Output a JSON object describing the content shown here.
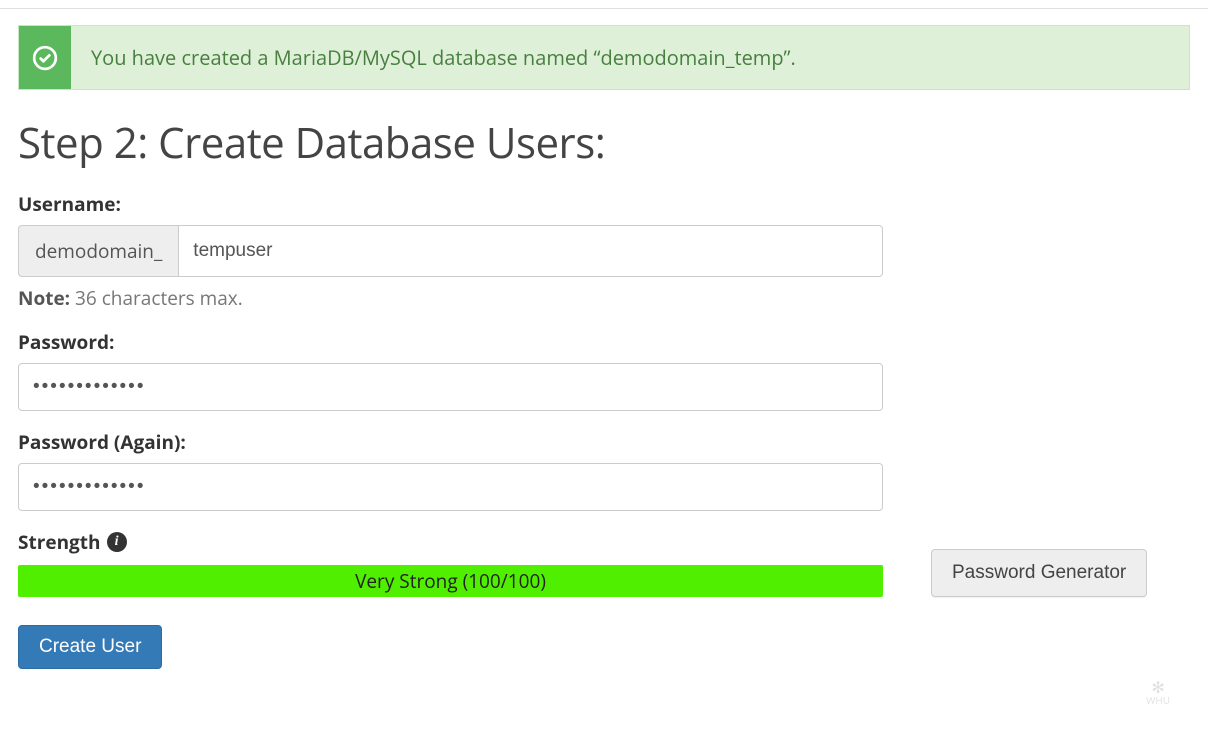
{
  "alert": {
    "message": "You have created a MariaDB/MySQL database named “demodomain_temp”."
  },
  "heading": "Step 2: Create Database Users:",
  "username": {
    "label": "Username:",
    "prefix": "demodomain_",
    "value": "tempuser",
    "note_label": "Note:",
    "note_text": " 36 characters max."
  },
  "password": {
    "label": "Password:",
    "value": "•••••••••••••"
  },
  "password_again": {
    "label": "Password (Again):",
    "value": "•••••••••••••"
  },
  "strength": {
    "label": "Strength",
    "bar_text": "Very Strong (100/100)",
    "bar_color": "#50ef00",
    "percent": 100
  },
  "buttons": {
    "generator": "Password Generator",
    "create": "Create User"
  },
  "watermark": {
    "label": "WHU"
  }
}
